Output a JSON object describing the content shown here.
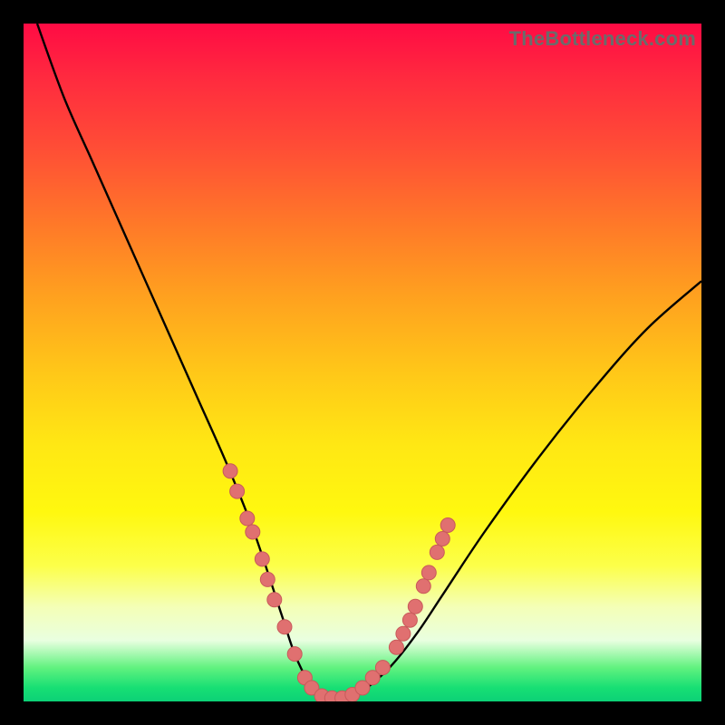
{
  "watermark": "TheBottleneck.com",
  "colors": {
    "dot_fill": "#e07070",
    "dot_stroke": "#c85a5a",
    "curve": "#000000"
  },
  "chart_data": {
    "type": "line",
    "title": "",
    "xlabel": "",
    "ylabel": "",
    "xlim": [
      0,
      100
    ],
    "ylim": [
      0,
      100
    ],
    "grid": false,
    "legend": false,
    "notes": "V-shaped bottleneck curve on a rainbow gradient background. No axis ticks or numeric labels are visible. The curve reaches its minimum (≈0) at x≈40–48, with a flat bottom; left branch rises steeply to ≈100 at x≈2 and right branch rises to ≈62 at x≈100. Salmon dots mark sample points along the lower portions of both branches.",
    "series": [
      {
        "name": "bottleneck-curve",
        "x": [
          2,
          6,
          10,
          14,
          18,
          22,
          26,
          30,
          34,
          38,
          40,
          42,
          44,
          46,
          48,
          50,
          54,
          58,
          62,
          68,
          76,
          84,
          92,
          100
        ],
        "y": [
          100,
          89,
          80,
          71,
          62,
          53,
          44,
          35,
          25,
          13,
          7,
          3,
          1,
          0.5,
          0.5,
          1.5,
          5,
          10,
          16,
          25,
          36,
          46,
          55,
          62
        ]
      }
    ],
    "dots": [
      {
        "x": 30.5,
        "y": 34
      },
      {
        "x": 31.5,
        "y": 31
      },
      {
        "x": 33.0,
        "y": 27
      },
      {
        "x": 33.8,
        "y": 25
      },
      {
        "x": 35.2,
        "y": 21
      },
      {
        "x": 36.0,
        "y": 18
      },
      {
        "x": 37.0,
        "y": 15
      },
      {
        "x": 38.5,
        "y": 11
      },
      {
        "x": 40.0,
        "y": 7
      },
      {
        "x": 41.5,
        "y": 3.5
      },
      {
        "x": 42.5,
        "y": 2
      },
      {
        "x": 44.0,
        "y": 0.8
      },
      {
        "x": 45.5,
        "y": 0.5
      },
      {
        "x": 47.0,
        "y": 0.5
      },
      {
        "x": 48.5,
        "y": 1
      },
      {
        "x": 50.0,
        "y": 2
      },
      {
        "x": 51.5,
        "y": 3.5
      },
      {
        "x": 53.0,
        "y": 5
      },
      {
        "x": 55.0,
        "y": 8
      },
      {
        "x": 56.0,
        "y": 10
      },
      {
        "x": 57.0,
        "y": 12
      },
      {
        "x": 57.8,
        "y": 14
      },
      {
        "x": 59.0,
        "y": 17
      },
      {
        "x": 59.8,
        "y": 19
      },
      {
        "x": 61.0,
        "y": 22
      },
      {
        "x": 61.8,
        "y": 24
      },
      {
        "x": 62.6,
        "y": 26
      }
    ]
  }
}
